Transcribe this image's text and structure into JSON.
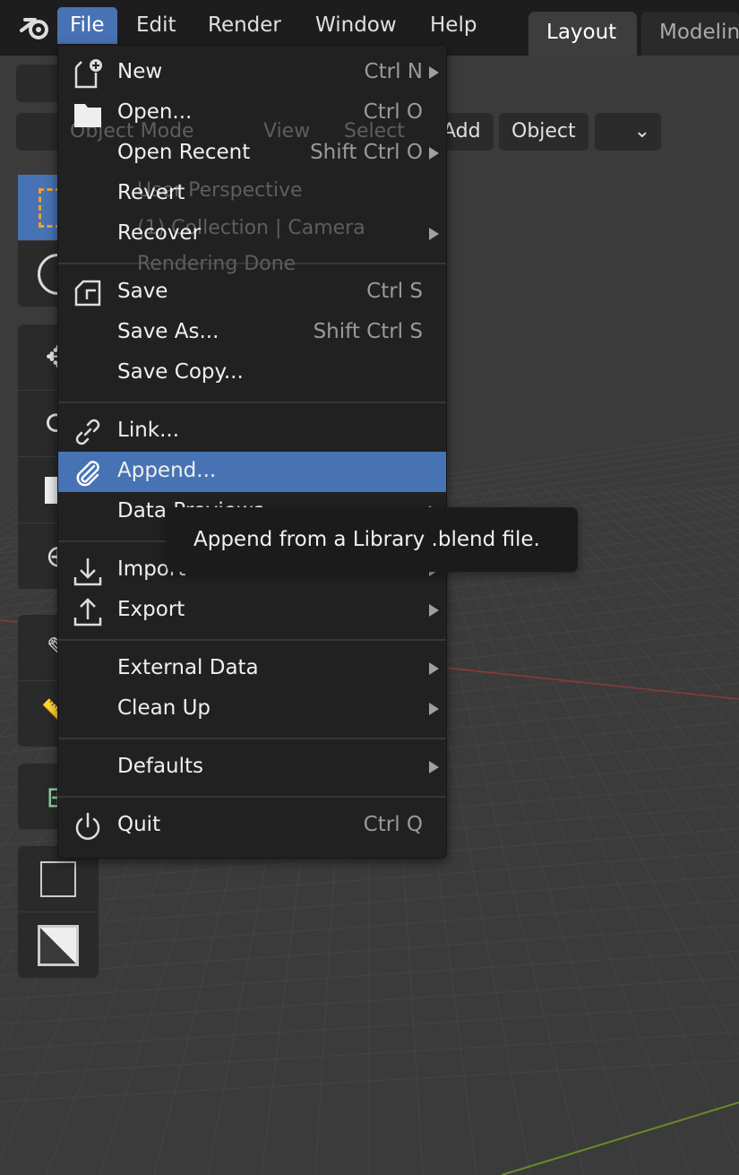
{
  "topbar": {
    "menus": [
      "File",
      "Edit",
      "Render",
      "Window",
      "Help"
    ],
    "workspace_tabs": [
      "Layout",
      "Modelin"
    ]
  },
  "viewport_header": {
    "mode": "Object Mode",
    "view": "View",
    "select": "Select",
    "add": "Add",
    "object": "Object"
  },
  "overlay": {
    "line1": "User Perspective",
    "line2": "(1) Collection | Camera",
    "line3": "Rendering Done"
  },
  "file_menu": {
    "items": [
      {
        "label": "New",
        "shortcut": "Ctrl N",
        "submenu": true,
        "icon": "new-file-icon"
      },
      {
        "label": "Open...",
        "shortcut": "Ctrl O",
        "submenu": false,
        "icon": "folder-icon"
      },
      {
        "label": "Open Recent",
        "shortcut": "Shift Ctrl O",
        "submenu": true,
        "icon": ""
      },
      {
        "label": "Revert",
        "shortcut": "",
        "submenu": false,
        "icon": ""
      },
      {
        "label": "Recover",
        "shortcut": "",
        "submenu": true,
        "icon": ""
      },
      {
        "separator": true
      },
      {
        "label": "Save",
        "shortcut": "Ctrl S",
        "submenu": false,
        "icon": "save-icon"
      },
      {
        "label": "Save As...",
        "shortcut": "Shift Ctrl S",
        "submenu": false,
        "icon": ""
      },
      {
        "label": "Save Copy...",
        "shortcut": "",
        "submenu": false,
        "icon": ""
      },
      {
        "separator": true
      },
      {
        "label": "Link...",
        "shortcut": "",
        "submenu": false,
        "icon": "link-icon"
      },
      {
        "label": "Append...",
        "shortcut": "",
        "submenu": false,
        "icon": "paperclip-icon",
        "highlighted": true
      },
      {
        "label": "Data Previews",
        "shortcut": "",
        "submenu": true,
        "icon": ""
      },
      {
        "separator": true
      },
      {
        "label": "Import",
        "shortcut": "",
        "submenu": true,
        "icon": "import-icon"
      },
      {
        "label": "Export",
        "shortcut": "",
        "submenu": true,
        "icon": "export-icon"
      },
      {
        "separator": true
      },
      {
        "label": "External Data",
        "shortcut": "",
        "submenu": true,
        "icon": ""
      },
      {
        "label": "Clean Up",
        "shortcut": "",
        "submenu": true,
        "icon": ""
      },
      {
        "separator": true
      },
      {
        "label": "Defaults",
        "shortcut": "",
        "submenu": true,
        "icon": ""
      },
      {
        "separator": true
      },
      {
        "label": "Quit",
        "shortcut": "Ctrl Q",
        "submenu": false,
        "icon": "power-icon"
      }
    ]
  },
  "tooltip": {
    "text": "Append from a Library .blend file."
  },
  "colors": {
    "accent": "#4772b3",
    "menu_bg": "#212121",
    "topbar_bg": "#1d1d1d",
    "viewport_bg": "#3b3b3b",
    "x_axis": "#8a3a3a",
    "y_axis": "#6a8a2a"
  }
}
